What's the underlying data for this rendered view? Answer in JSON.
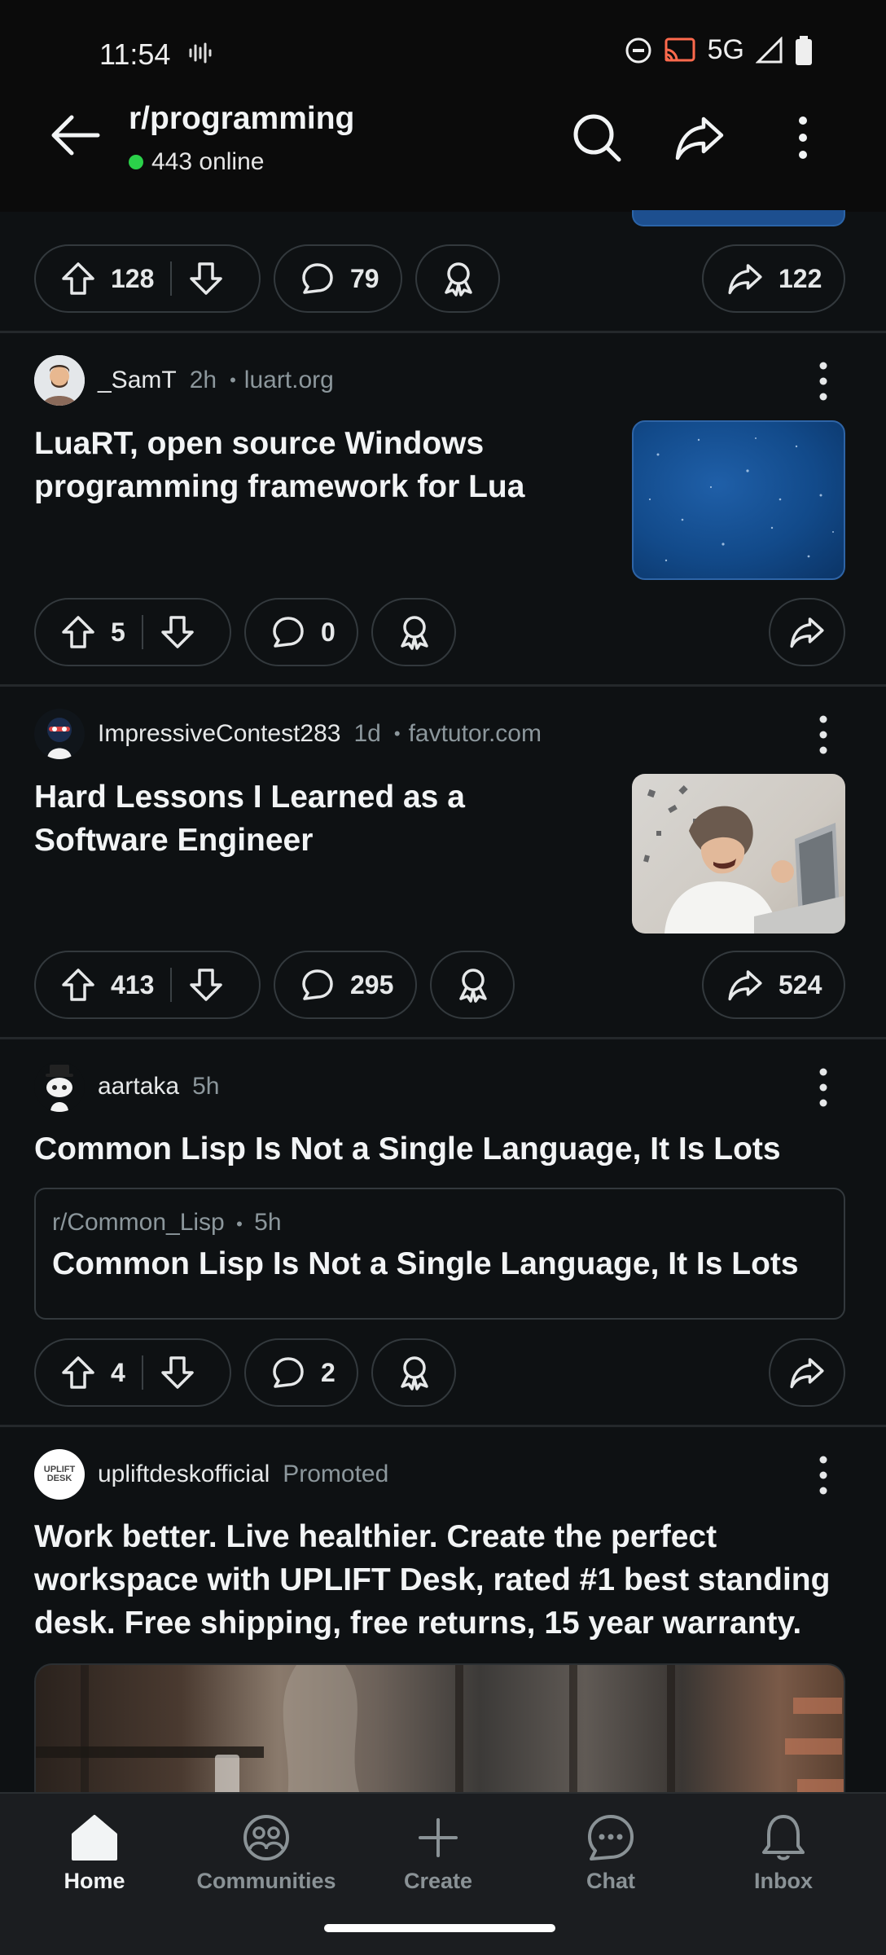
{
  "status_bar": {
    "time": "11:54",
    "network": "5G"
  },
  "header": {
    "title": "r/programming",
    "online": "443 online",
    "online_color": "#2bd14a"
  },
  "top_actions": {
    "upvotes": "128",
    "comments": "79",
    "shares": "122"
  },
  "posts": [
    {
      "author": "_SamT",
      "age": "2h",
      "domain": "luart.org",
      "title_line1": "LuaRT, open source Windows",
      "title_line2": "programming framework for Lua",
      "upvotes": "5",
      "comments": "0"
    },
    {
      "author": "ImpressiveContest283",
      "age": "1d",
      "domain": "favtutor.com",
      "title_line1": "Hard Lessons I Learned as a",
      "title_line2": "Software Engineer",
      "upvotes": "413",
      "comments": "295",
      "shares": "524"
    },
    {
      "author": "aartaka",
      "age": "5h",
      "title": "Common Lisp Is Not a Single Language, It Is Lots",
      "crosspost_sub": "r/Common_Lisp",
      "crosspost_age": "5h",
      "crosspost_title": "Common Lisp Is Not a Single Language, It Is Lots",
      "upvotes": "4",
      "comments": "2"
    },
    {
      "author": "upliftdeskofficial",
      "tag": "Promoted",
      "avatar_text": "UPLIFT DESK",
      "title_line1": "Work better. Live healthier. Create the perfect",
      "title_line2": "workspace with UPLIFT Desk, rated #1 best standing",
      "title_line3": "desk. Free shipping, free returns, 15 year warranty."
    }
  ],
  "bottom_nav": [
    {
      "label": "Home",
      "icon": "home-icon",
      "active": true
    },
    {
      "label": "Communities",
      "icon": "communities-icon"
    },
    {
      "label": "Create",
      "icon": "plus-icon"
    },
    {
      "label": "Chat",
      "icon": "chat-icon"
    },
    {
      "label": "Inbox",
      "icon": "bell-icon"
    }
  ]
}
